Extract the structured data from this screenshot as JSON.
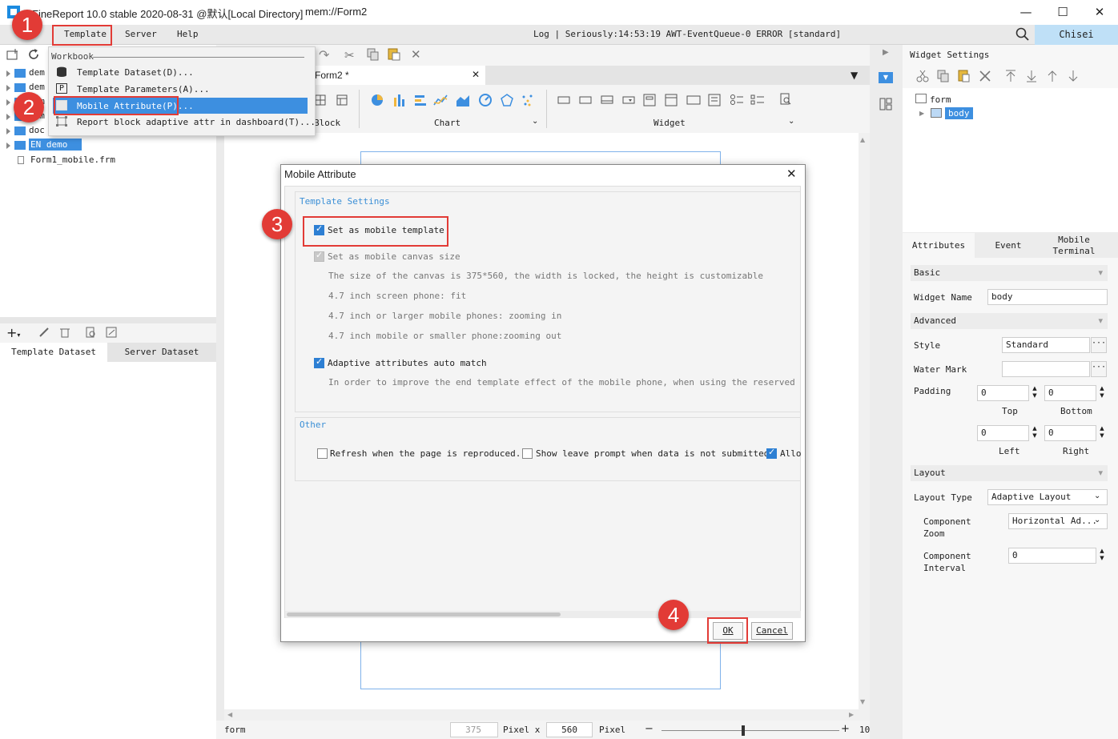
{
  "window": {
    "title": "FineReport 10.0 stable 2020-08-31 @默认[Local Directory]",
    "path": "mem://Form2",
    "controls": [
      "—",
      "☐",
      "✕"
    ]
  },
  "menubar": {
    "items": [
      "Template",
      "Server",
      "Help"
    ],
    "log": "Log | Seriously:14:53:19 AWT-EventQueue-0 ERROR [standard]",
    "user": "Chisei"
  },
  "template_menu": {
    "section": "Workbook",
    "items": [
      "Template Dataset(D)...",
      "Template Parameters(A)...",
      "Mobile Attribute(P)...",
      "Report block adaptive attr in dashboard(T)..."
    ]
  },
  "file_tree": {
    "items": [
      "dem",
      "dem",
      "dem",
      "dem",
      "doc",
      "EN demo",
      "Form1_mobile.frm"
    ]
  },
  "dataset_tabs": [
    "Template Dataset",
    "Server Dataset"
  ],
  "editor": {
    "tab": "Form2 *",
    "toolbar_groups": [
      "Block",
      "Chart",
      "Widget"
    ]
  },
  "widget_settings": {
    "title": "Widget Settings",
    "tree": [
      "form",
      "body"
    ]
  },
  "properties": {
    "tabs": [
      "Attributes",
      "Event",
      "Mobile Terminal"
    ],
    "sections": [
      "Basic",
      "Advanced",
      "Layout"
    ],
    "widget_name_label": "Widget Name",
    "widget_name": "body",
    "style_label": "Style",
    "style_value": "Standard",
    "watermark_label": "Water Mark",
    "watermark_value": "",
    "padding_label": "Padding",
    "padding": {
      "top": "0",
      "bottom": "0",
      "left": "0",
      "right": "0"
    },
    "padding_captions": [
      "Top",
      "Bottom",
      "Left",
      "Right"
    ],
    "layout_type_label": "Layout Type",
    "layout_type": "Adaptive Layout",
    "component_zoom_label": [
      "Component",
      "Zoom"
    ],
    "component_zoom": "Horizontal Ad...",
    "component_interval_label": [
      "Component",
      "Interval"
    ],
    "component_interval": "0"
  },
  "dialog": {
    "title": "Mobile Attribute",
    "section1": "Template Settings",
    "set_mobile": "Set as mobile template",
    "set_canvas": "Set as mobile canvas size",
    "canvas_lines": [
      "The size of the canvas is 375*560, the width is locked, the height is customizable",
      "4.7 inch screen phone: fit",
      "4.7 inch or larger mobile phones: zooming in",
      "4.7 inch mobile or smaller phone:zooming out"
    ],
    "adaptive": "Adaptive attributes auto match",
    "adaptive_desc": "In order to improve the end template effect of the mobile phone, when using the reserved layout fu",
    "section2": "Other",
    "other_options": [
      "Refresh when the page is reproduced.",
      "Show leave prompt when data is not submitted",
      "Allo"
    ],
    "ok": "OK",
    "cancel": "Cancel"
  },
  "status": {
    "mode": "form",
    "width": "375",
    "unit1": "Pixel x",
    "height": "560",
    "unit2": "Pixel",
    "zoom": "10"
  },
  "badges": [
    "1",
    "2",
    "3",
    "4"
  ],
  "colors": {
    "accent": "#2d7fd3",
    "highlight": "#3d8fe0",
    "annotation": "#e23b36",
    "user_bg": "#bfe0f7"
  }
}
